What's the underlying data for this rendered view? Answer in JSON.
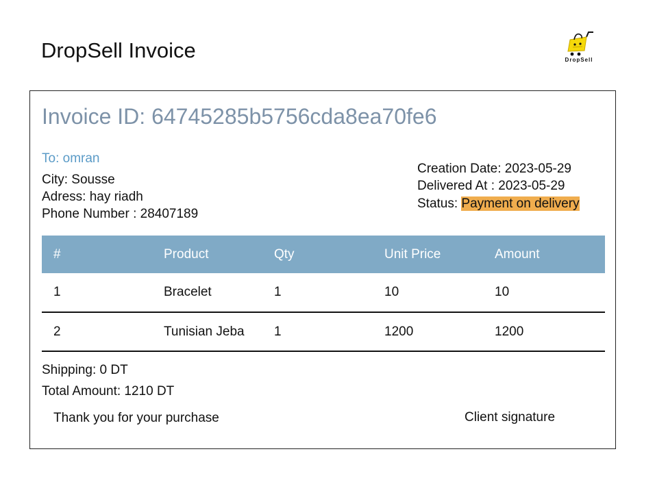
{
  "header": {
    "title": "DropSell Invoice",
    "logo_text": "DropSell",
    "logo_icon": "shopping-bag-cart-icon",
    "logo_color": "#f5d90a"
  },
  "invoice": {
    "id_label": "Invoice ID: 64745285b5756cda8ea70fe6",
    "to": "To: omran",
    "city": "City: Sousse",
    "address": "Adress: hay riadh",
    "phone": "Phone Number : 28407189",
    "creation_date": "Creation Date: 2023-05-29",
    "delivered_at": "Delivered At : 2023-05-29",
    "status_label": "Status: ",
    "status_value": "Payment on delivery",
    "status_color": "#f0ad4e",
    "accent_color": "#80aac6"
  },
  "table": {
    "headers": [
      "#",
      "Product",
      "Qty",
      "Unit Price",
      "Amount"
    ],
    "rows": [
      [
        "1",
        "Bracelet",
        "1",
        "10",
        "10"
      ],
      [
        "2",
        "Tunisian Jeba",
        "1",
        "1200",
        "1200"
      ]
    ]
  },
  "summary": {
    "shipping": "Shipping: 0 DT",
    "total": "Total Amount: 1210 DT"
  },
  "footer": {
    "thanks": "Thank you for your purchase",
    "signature": "Client signature"
  }
}
